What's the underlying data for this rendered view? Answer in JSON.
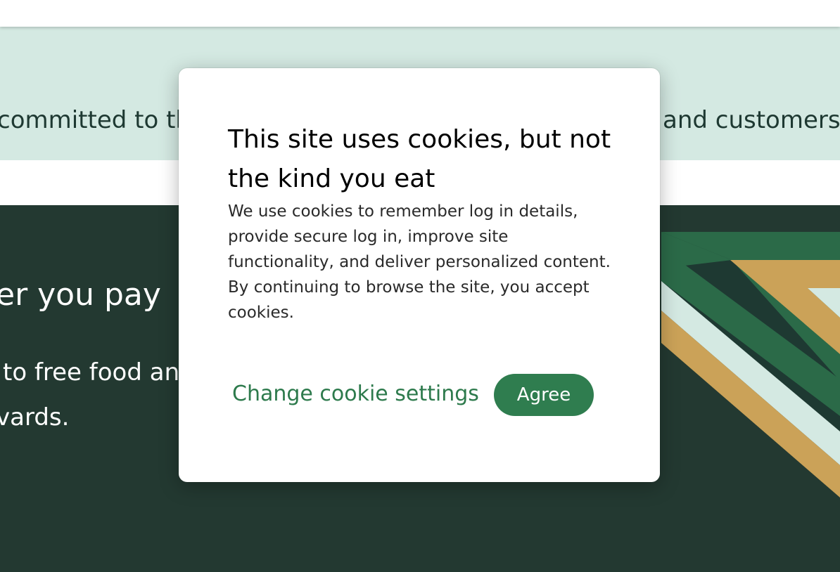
{
  "announcement": {
    "left_fragment": "committed to th",
    "right_fragment": "and customers."
  },
  "hero": {
    "heading_fragment": "er you pay",
    "line1_fragment": "to free food an",
    "line2_fragment": "vards."
  },
  "cookie_modal": {
    "title": "This site uses cookies, but not the kind you eat",
    "body": "We use cookies to remember log in details, provide secure log in, improve site functionality, and deliver personalized content. By continuing to browse the site, you accept cookies.",
    "change_settings_label": "Change cookie settings",
    "agree_label": "Agree"
  },
  "colors": {
    "house_green": "#1e3932",
    "hero_background": "#233931",
    "accent_green": "#2f7d4f",
    "light_green_band": "#d4e9e2",
    "gold_stripe": "#cba258"
  }
}
